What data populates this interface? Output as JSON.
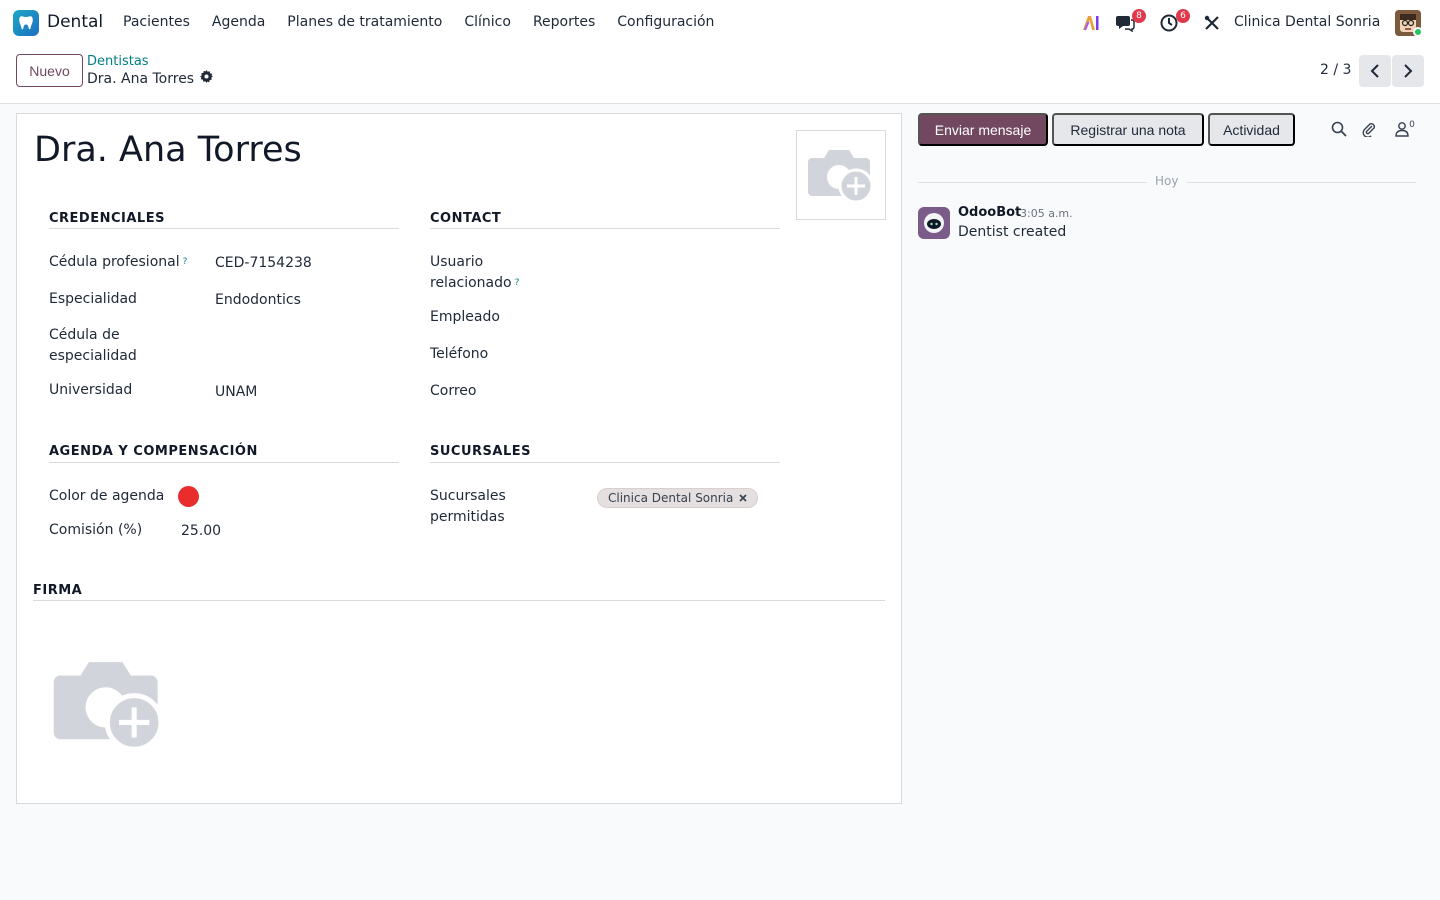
{
  "app": {
    "name": "Dental"
  },
  "menu": [
    "Pacientes",
    "Agenda",
    "Planes de tratamiento",
    "Clínico",
    "Reportes",
    "Configuración"
  ],
  "systray": {
    "messages_count": "8",
    "activities_count": "6",
    "company": "Clinica Dental Sonria"
  },
  "control": {
    "new_label": "Nuevo",
    "breadcrumb_parent": "Dentistas",
    "breadcrumb_current": "Dra. Ana Torres",
    "pager": "2 / 3"
  },
  "form": {
    "title": "Dra. Ana Torres",
    "credenciales": {
      "title": "CREDENCIALES",
      "cedula_label": "Cédula profesional",
      "cedula_value": "CED-7154238",
      "especialidad_label": "Especialidad",
      "especialidad_value": "Endodontics",
      "cedula_esp_label_1": "Cédula de",
      "cedula_esp_label_2": "especialidad",
      "universidad_label": "Universidad",
      "universidad_value": "UNAM"
    },
    "contact": {
      "title": "CONTACT",
      "usuario_label_1": "Usuario",
      "usuario_label_2": "relacionado",
      "empleado_label": "Empleado",
      "telefono_label": "Teléfono",
      "correo_label": "Correo"
    },
    "agenda": {
      "title": "AGENDA Y COMPENSACIÓN",
      "color_label": "Color de agenda",
      "color_value": "#e92d2d",
      "comision_label": "Comisión (%)",
      "comision_value": "25.00"
    },
    "sucursales": {
      "title": "SUCURSALES",
      "label_1": "Sucursales",
      "label_2": "permitidas",
      "tags": [
        "Clinica Dental Sonria"
      ]
    },
    "firma": {
      "title": "FIRMA"
    },
    "help_mark": "?"
  },
  "chatter": {
    "send_label": "Enviar mensaje",
    "note_label": "Registrar una nota",
    "activity_label": "Actividad",
    "followers_count": "0",
    "date_separator": "Hoy",
    "messages": [
      {
        "author": "OdooBot",
        "time": "3:05 a.m.",
        "body": "Dentist created"
      }
    ]
  },
  "colors": {
    "primary": "#71485f",
    "link": "#017e84",
    "badge": "#e0394b"
  }
}
